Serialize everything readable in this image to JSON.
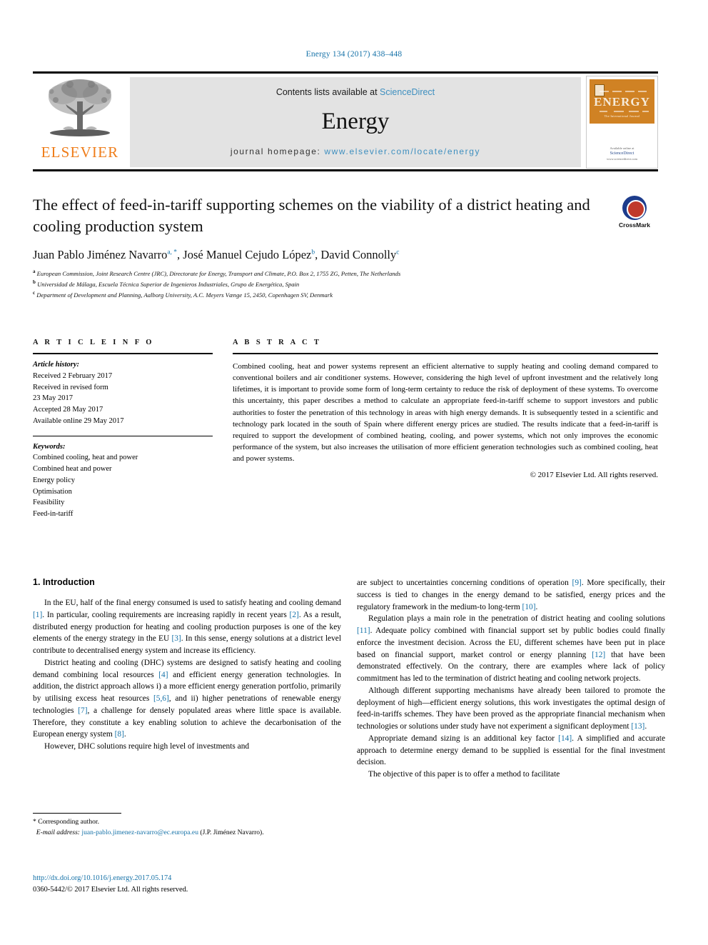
{
  "running_head": "Energy 134 (2017) 438–448",
  "masthead": {
    "contents_prefix": "Contents lists available at ",
    "sciencedirect": "ScienceDirect",
    "journal_name": "Energy",
    "homepage_prefix": "journal homepage: ",
    "homepage_url": "www.elsevier.com/locate/energy",
    "publisher_wordmark": "ELSEVIER",
    "publisher_color": "#ef7d1a",
    "cover": {
      "title": "ENERGY",
      "subtitle": "The International Journal",
      "footer_line1": "Available online at",
      "footer_line2": "ScienceDirect",
      "footer_line3": "www.sciencedirect.com",
      "background": "#d08224"
    }
  },
  "article": {
    "title": "The effect of feed-in-tariff supporting schemes on the viability of a district heating and cooling production system",
    "crossmark_label": "CrossMark",
    "authors": [
      {
        "name": "Juan Pablo Jiménez Navarro",
        "marks": "a, *"
      },
      {
        "name": "José Manuel Cejudo López",
        "marks": "b"
      },
      {
        "name": "David Connolly",
        "marks": "c"
      }
    ],
    "affiliations": [
      {
        "marker": "a",
        "text": "European Commission, Joint Research Centre (JRC), Directorate for Energy, Transport and Climate, P.O. Box 2, 1755 ZG, Petten, The Netherlands"
      },
      {
        "marker": "b",
        "text": "Universidad de Málaga, Escuela Técnica Superior de Ingenieros Industriales, Grupo de Energética, Spain"
      },
      {
        "marker": "c",
        "text": "Department of Development and Planning, Aalborg University, A.C. Meyers Vænge 15, 2450, Copenhagen SV, Denmark"
      }
    ]
  },
  "article_info": {
    "heading": "A R T I C L E  I N F O",
    "history_label": "Article history:",
    "history_lines": [
      "Received 2 February 2017",
      "Received in revised form",
      "23 May 2017",
      "Accepted 28 May 2017",
      "Available online 29 May 2017"
    ],
    "keywords_label": "Keywords:",
    "keywords": [
      "Combined cooling, heat and power",
      "Combined heat and power",
      "Energy policy",
      "Optimisation",
      "Feasibility",
      "Feed-in-tariff"
    ]
  },
  "abstract": {
    "heading": "A B S T R A C T",
    "text": "Combined cooling, heat and power systems represent an efficient alternative to supply heating and cooling demand compared to conventional boilers and air conditioner systems. However, considering the high level of upfront investment and the relatively long lifetimes, it is important to provide some form of long-term certainty to reduce the risk of deployment of these systems. To overcome this uncertainty, this paper describes a method to calculate an appropriate feed-in-tariff scheme to support investors and public authorities to foster the penetration of this technology in areas with high energy demands. It is subsequently tested in a scientific and technology park located in the south of Spain where different energy prices are studied. The results indicate that a feed-in-tariff is required to support the development of combined heating, cooling, and power systems, which not only improves the economic performance of the system, but also increases the utilisation of more efficient generation technologies such as combined cooling, heat and power systems.",
    "copyright": "© 2017 Elsevier Ltd. All rights reserved."
  },
  "introduction": {
    "heading": "1. Introduction",
    "left_paragraphs": [
      "In the EU, half of the final energy consumed is used to satisfy heating and cooling demand [1]. In particular, cooling requirements are increasing rapidly in recent years [2]. As a result, distributed energy production for heating and cooling production purposes is one of the key elements of the energy strategy in the EU [3]. In this sense, energy solutions at a district level contribute to decentralised energy system and increase its efficiency.",
      "District heating and cooling (DHC) systems are designed to satisfy heating and cooling demand combining local resources [4] and efficient energy generation technologies. In addition, the district approach allows i) a more efficient energy generation portfolio, primarily by utilising excess heat resources [5,6], and ii) higher penetrations of renewable energy technologies [7], a challenge for densely populated areas where little space is available. Therefore, they constitute a key enabling solution to achieve the decarbonisation of the European energy system [8].",
      "However, DHC solutions require high level of investments and"
    ],
    "right_paragraphs": [
      "are subject to uncertainties concerning conditions of operation [9]. More specifically, their success is tied to changes in the energy demand to be satisfied, energy prices and the regulatory framework in the medium-to long-term [10].",
      "Regulation plays a main role in the penetration of district heating and cooling solutions [11]. Adequate policy combined with financial support set by public bodies could finally enforce the investment decision. Across the EU, different schemes have been put in place based on financial support, market control or energy planning [12] that have been demonstrated effectively. On the contrary, there are examples where lack of policy commitment has led to the termination of district heating and cooling network projects.",
      "Although different supporting mechanisms have already been tailored to promote the deployment of high—efficient energy solutions, this work investigates the optimal design of feed-in-tariffs schemes. They have been proved as the appropriate financial mechanism when technologies or solutions under study have not experiment a significant deployment [13].",
      "Appropriate demand sizing is an additional key factor [14]. A simplified and accurate approach to determine energy demand to be supplied is essential for the final investment decision.",
      "The objective of this paper is to offer a method to facilitate"
    ]
  },
  "footnote": {
    "corresponding": "* Corresponding author.",
    "email_label": "E-mail address:",
    "email": "juan-pablo.jimenez-navarro@ec.europa.eu",
    "email_suffix": "(J.P. Jiménez Navarro).",
    "doi": "http://dx.doi.org/10.1016/j.energy.2017.05.174",
    "issn_line": "0360-5442/© 2017 Elsevier Ltd. All rights reserved."
  }
}
